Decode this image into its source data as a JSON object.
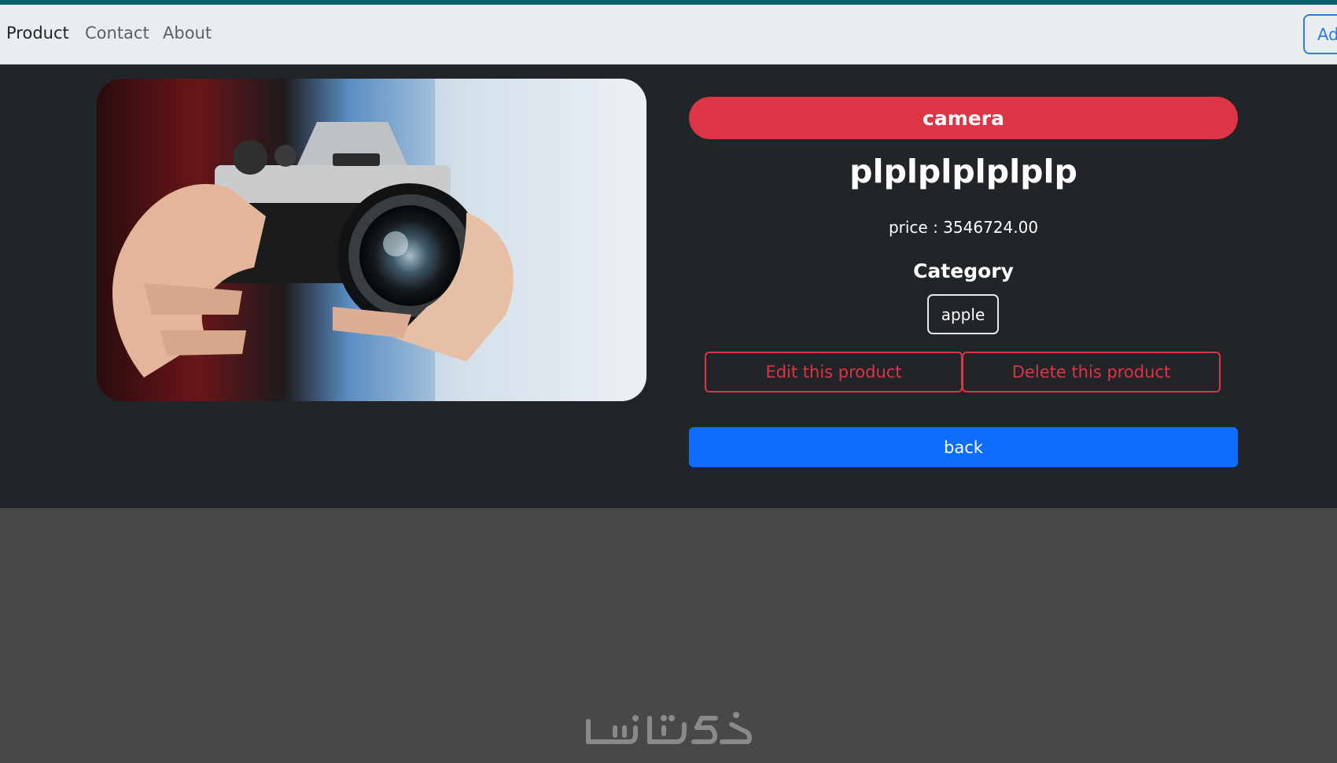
{
  "navbar": {
    "links": [
      {
        "label": "Product",
        "active": true
      },
      {
        "label": "Contact",
        "active": false
      },
      {
        "label": "About",
        "active": false
      }
    ],
    "add_button_label": "Ad"
  },
  "product": {
    "image_icon": "camera-photo",
    "badge": "camera",
    "title": "plplplplplplp",
    "price_text": "price : 3546724.00",
    "category_heading": "Category",
    "category_tag": "apple",
    "edit_label": "Edit this product",
    "delete_label": "Delete this product",
    "back_label": "back"
  },
  "watermark": {
    "text": "خمسات"
  },
  "colors": {
    "navbar_bg": "#eaedf0",
    "hero_bg": "#212429",
    "page_bg": "#484846",
    "danger": "#dc3545",
    "primary": "#0d6efd",
    "topline": "#0c5f6a"
  }
}
